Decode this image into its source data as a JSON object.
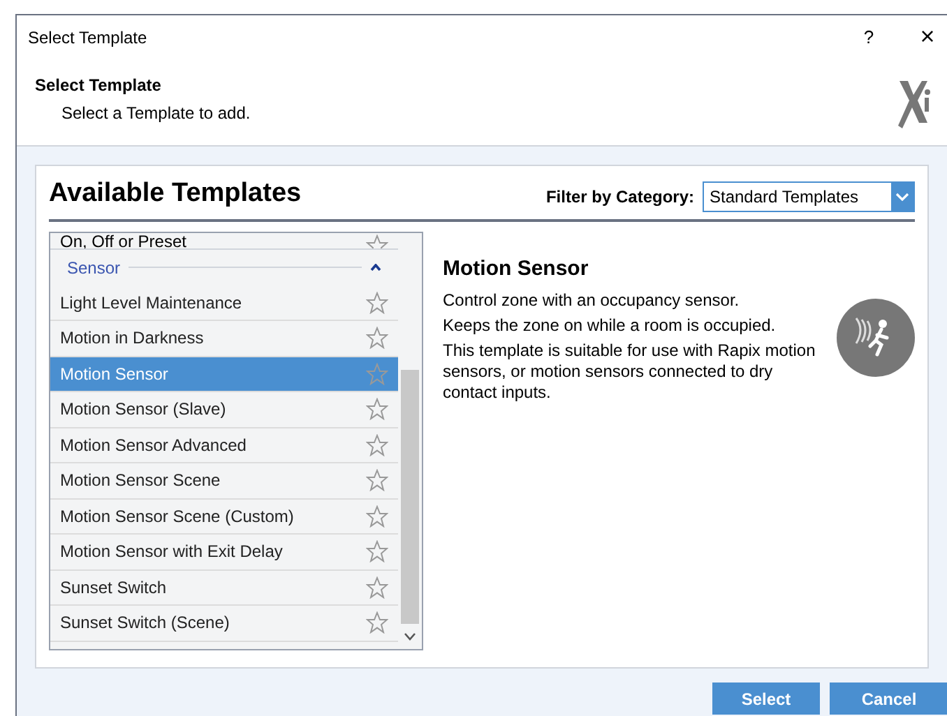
{
  "window": {
    "title": "Select Template",
    "help": "?",
    "close": "×"
  },
  "header": {
    "title": "Select Template",
    "subtitle": "Select a Template to add."
  },
  "panel": {
    "title": "Available Templates",
    "filter_label": "Filter by Category:",
    "filter_value": "Standard Templates"
  },
  "list": {
    "clipped_item": "On, Off or Preset",
    "group": "Sensor",
    "group_expanded": true,
    "items": [
      {
        "label": "Light Level Maintenance",
        "selected": false
      },
      {
        "label": "Motion in Darkness",
        "selected": false
      },
      {
        "label": "Motion Sensor",
        "selected": true
      },
      {
        "label": "Motion Sensor (Slave)",
        "selected": false
      },
      {
        "label": "Motion Sensor Advanced",
        "selected": false
      },
      {
        "label": "Motion Sensor Scene",
        "selected": false
      },
      {
        "label": "Motion Sensor Scene (Custom)",
        "selected": false
      },
      {
        "label": "Motion Sensor with Exit Delay",
        "selected": false
      },
      {
        "label": "Sunset Switch",
        "selected": false
      },
      {
        "label": "Sunset Switch (Scene)",
        "selected": false
      }
    ]
  },
  "detail": {
    "title": "Motion Sensor",
    "paragraphs": [
      "Control zone with an occupancy sensor.",
      "Keeps the zone on while a room is occupied.",
      "This template is suitable for use with Rapix motion sensors, or motion sensors connected to dry contact inputs."
    ]
  },
  "buttons": [
    "Select",
    "Cancel"
  ]
}
